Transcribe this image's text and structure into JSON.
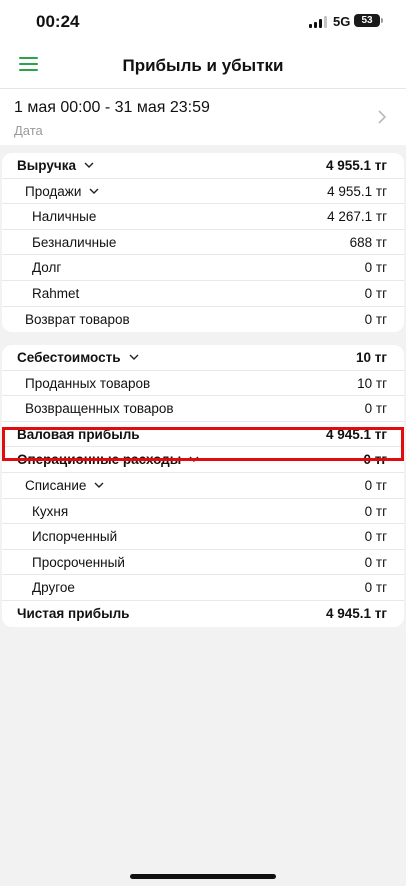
{
  "status_bar": {
    "time": "00:24",
    "network": "5G",
    "battery": "53"
  },
  "header": {
    "title": "Прибыль и убытки",
    "menu_icon": "hamburger-menu-icon"
  },
  "period": {
    "range": "1 мая 00:00 - 31 мая 23:59",
    "label": "Дата"
  },
  "revenue": {
    "label": "Выручка",
    "value": "4 955.1 тг",
    "sales": {
      "label": "Продажи",
      "value": "4 955.1 тг"
    },
    "items": [
      {
        "label": "Наличные",
        "value": "4 267.1 тг"
      },
      {
        "label": "Безналичные",
        "value": "688 тг"
      },
      {
        "label": "Долг",
        "value": "0 тг"
      },
      {
        "label": "Rahmet",
        "value": "0 тг"
      }
    ],
    "returns": {
      "label": "Возврат товаров",
      "value": "0 тг"
    }
  },
  "cost": {
    "label": "Себестоимость",
    "value": "10 тг",
    "items": [
      {
        "label": "Проданных товаров",
        "value": "10 тг"
      },
      {
        "label": "Возвращенных товаров",
        "value": "0 тг"
      }
    ]
  },
  "gross_profit": {
    "label": "Валовая прибыль",
    "value": "4 945.1 тг"
  },
  "operating": {
    "label": "Операционные расходы",
    "value": "0 тг",
    "writeoff": {
      "label": "Списание",
      "value": "0 тг"
    },
    "items": [
      {
        "label": "Кухня",
        "value": "0 тг"
      },
      {
        "label": "Испорченный",
        "value": "0 тг"
      },
      {
        "label": "Просроченный",
        "value": "0 тг"
      },
      {
        "label": "Другое",
        "value": "0 тг"
      }
    ]
  },
  "net_profit": {
    "label": "Чистая прибыль",
    "value": "4 945.1 тг"
  },
  "colors": {
    "accent": "#2aa34a",
    "highlight": "#e10d0d"
  }
}
